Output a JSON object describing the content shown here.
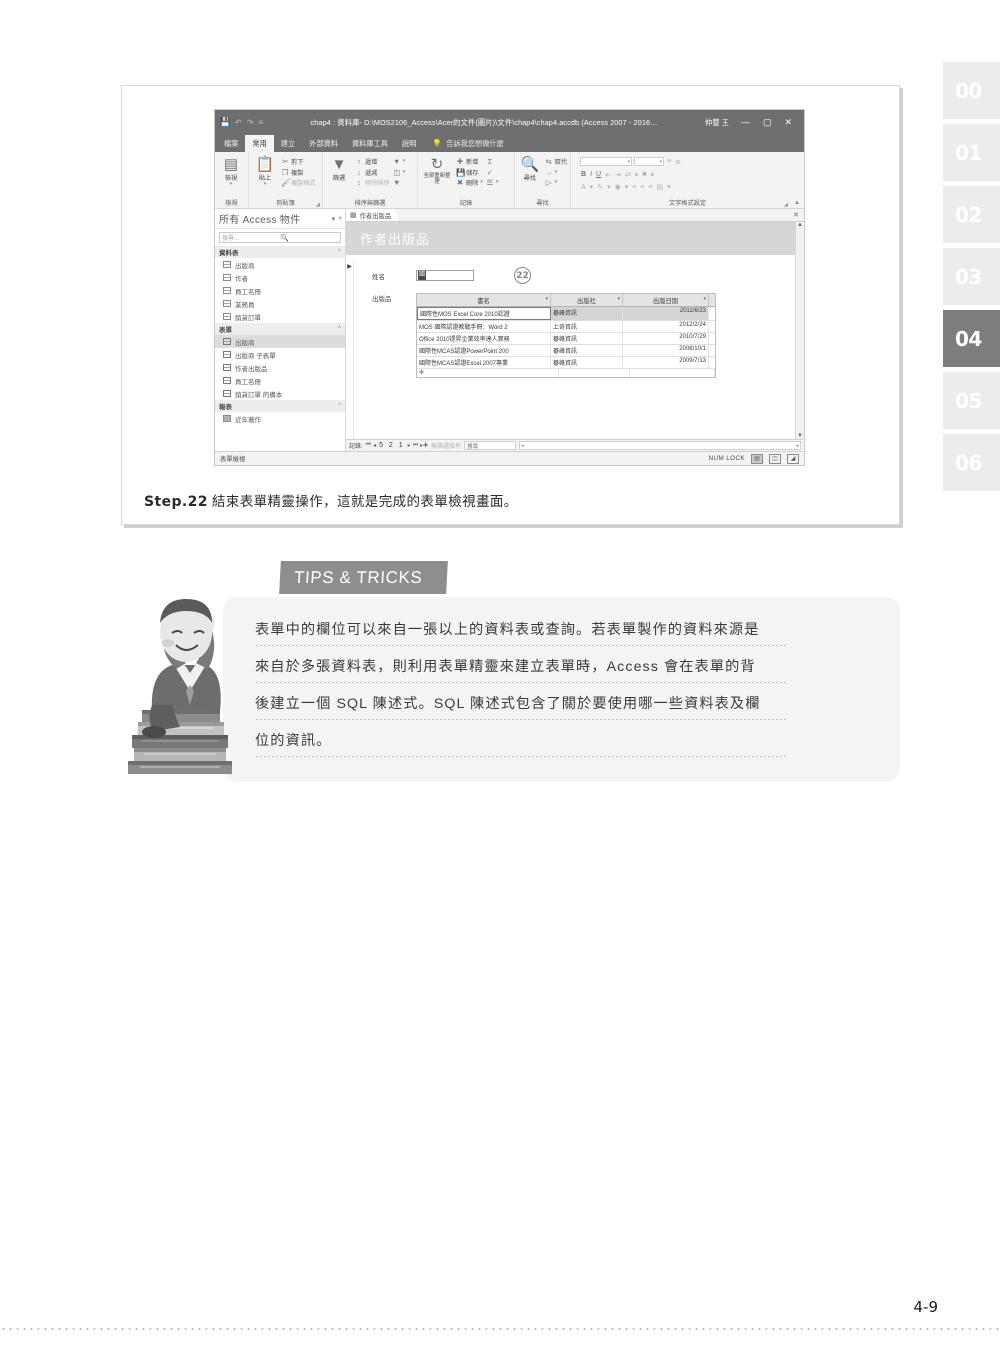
{
  "chapter_tabs": [
    {
      "label": "00",
      "active": false
    },
    {
      "label": "01",
      "active": false
    },
    {
      "label": "02",
      "active": false
    },
    {
      "label": "03",
      "active": false
    },
    {
      "label": "04",
      "active": true
    },
    {
      "label": "05",
      "active": false
    },
    {
      "label": "06",
      "active": false
    }
  ],
  "access": {
    "titlebar": {
      "save_icon": "save-icon",
      "undo_icon": "undo-icon",
      "redo_icon": "redo-icon",
      "customize_icon": "customize-qat-icon",
      "title": "chap4 : 資料庫- D:\\MOS2106_Access\\Acer的文件(圖片)\\文件\\chap4\\chap4.accdb (Access 2007 - 2016…",
      "user": "仲豐 王",
      "minimize": "—",
      "maximize": "▢",
      "close": "✕"
    },
    "ribbon_tabs": [
      {
        "label": "檔案",
        "active": false
      },
      {
        "label": "常用",
        "active": true
      },
      {
        "label": "建立",
        "active": false
      },
      {
        "label": "外部資料",
        "active": false
      },
      {
        "label": "資料庫工具",
        "active": false
      },
      {
        "label": "說明",
        "active": false
      }
    ],
    "tell_me": "告訴我您想做什麼",
    "ribbon_groups": [
      {
        "name": "檢視",
        "big": {
          "label": "檢視",
          "icon": "view-icon"
        }
      },
      {
        "name": "剪貼簿",
        "big": {
          "label": "貼上",
          "icon": "paste-icon"
        },
        "items": [
          {
            "label": "剪下",
            "icon": "cut-icon",
            "dim": false
          },
          {
            "label": "複製",
            "icon": "copy-icon",
            "dim": false
          },
          {
            "label": "複製格式",
            "icon": "format-painter-icon",
            "dim": true
          }
        ]
      },
      {
        "name": "排序與篩選",
        "big": {
          "label": "篩選",
          "icon": "filter-icon"
        },
        "items": [
          {
            "label": "遞增",
            "icon": "sort-asc-icon",
            "dim": false
          },
          {
            "label": "遞減",
            "icon": "sort-desc-icon",
            "dim": false
          },
          {
            "label": "移除排序",
            "icon": "remove-sort-icon",
            "dim": true
          }
        ],
        "items2": [
          {
            "label": "",
            "icon": "advanced-filter-icon",
            "dim": false
          },
          {
            "label": "",
            "icon": "toggle-filter-icon",
            "dim": false
          },
          {
            "label": "",
            "icon": "filter-clear-icon",
            "dim": true
          }
        ]
      },
      {
        "name": "記錄",
        "big": {
          "label": "全部重新整理",
          "icon": "refresh-all-icon"
        },
        "items": [
          {
            "label": "新增",
            "icon": "new-record-icon",
            "dim": false
          },
          {
            "label": "儲存",
            "icon": "save-record-icon",
            "dim": false
          },
          {
            "label": "刪除",
            "icon": "delete-record-icon",
            "dim": false
          }
        ],
        "items2": [
          {
            "label": "",
            "icon": "totals-icon",
            "dim": false
          },
          {
            "label": "",
            "icon": "spelling-icon",
            "dim": false
          },
          {
            "label": "",
            "icon": "more-icon",
            "dim": false
          }
        ]
      },
      {
        "name": "尋找",
        "big": {
          "label": "尋找",
          "icon": "find-icon"
        },
        "items": [
          {
            "label": "取代",
            "icon": "replace-icon",
            "dim": false
          },
          {
            "label": "",
            "icon": "goto-icon",
            "dim": false
          },
          {
            "label": "",
            "icon": "select-icon",
            "dim": false
          }
        ]
      },
      {
        "name": "文字格式設定",
        "font_box": "",
        "size_box": "",
        "items": [
          {
            "icon": "bold-icon",
            "label": "B"
          },
          {
            "icon": "italic-icon",
            "label": "I"
          },
          {
            "icon": "underline-icon",
            "label": "U"
          }
        ]
      }
    ],
    "navpane": {
      "title": "所有 Access 物件",
      "dropdown_icon": "chevron-circle-icon",
      "collapse_icon": "double-chevron-left-icon",
      "search_placeholder": "搜尋...",
      "search_icon": "search-icon",
      "groups": [
        {
          "name": "資料表",
          "items": [
            {
              "label": "出版商",
              "type": "table",
              "selected": false
            },
            {
              "label": "作者",
              "type": "table",
              "selected": false
            },
            {
              "label": "員工名冊",
              "type": "table",
              "selected": false
            },
            {
              "label": "業務員",
              "type": "table",
              "selected": false
            },
            {
              "label": "銷貨訂單",
              "type": "table",
              "selected": false
            }
          ]
        },
        {
          "name": "表單",
          "items": [
            {
              "label": "出版商",
              "type": "form",
              "selected": true
            },
            {
              "label": "出版商 子表單",
              "type": "form",
              "selected": false
            },
            {
              "label": "作者出版品",
              "type": "form",
              "selected": false
            },
            {
              "label": "員工名冊",
              "type": "form",
              "selected": false
            },
            {
              "label": "銷貨訂單 的備本",
              "type": "form",
              "selected": false
            }
          ]
        },
        {
          "name": "報表",
          "items": [
            {
              "label": "近年著作",
              "type": "report",
              "selected": false
            }
          ]
        }
      ]
    },
    "doc_tab": {
      "label": "作者出版品",
      "icon": "form-icon",
      "close_icon": "close-icon"
    },
    "form": {
      "header_title": "作者出版品",
      "record_selector_icon": "record-arrow-icon",
      "fields": [
        {
          "label": "姓名",
          "value": "國",
          "callout": "22"
        },
        {
          "label": "出版品",
          "value": ""
        }
      ],
      "subform": {
        "columns": [
          "書名",
          "出版社",
          "出版日期"
        ],
        "rows": [
          {
            "title": "國際性MOS Excel Core 2010認證",
            "publisher": "碁峰資訊",
            "date": "2011/6/23"
          },
          {
            "title": "MOS 國際認證教戰手冊：Word 2",
            "publisher": "上奇資訊",
            "date": "2012/2/24"
          },
          {
            "title": "Office 2010提昇企業效率達人實務",
            "publisher": "碁峰資訊",
            "date": "2010/7/29"
          },
          {
            "title": "國際性MCAS認證PowerPoint 200",
            "publisher": "碁峰資訊",
            "date": "2008/10/1"
          },
          {
            "title": "國際性MCAS認證Excel 2007專業",
            "publisher": "碁峰資訊",
            "date": "2009/7/13"
          }
        ],
        "new_row_marker": "✻"
      },
      "navbar": {
        "label": "記錄:",
        "first_icon": "first-record-icon",
        "prev_icon": "prev-record-icon",
        "position": "5 2 1",
        "next_icon": "next-record-icon",
        "last_icon": "last-record-icon",
        "new_icon": "new-record-icon",
        "filter_status": "無篩選條件",
        "search_label": "搜尋",
        "search_value": ""
      }
    },
    "statusbar": {
      "left": "表單檢視",
      "numlock": "NUM LOCK",
      "views": [
        {
          "icon": "form-view-icon",
          "active": true
        },
        {
          "icon": "layout-view-icon",
          "active": false
        },
        {
          "icon": "design-view-icon",
          "active": false
        }
      ]
    }
  },
  "step_caption": {
    "number": "Step.22",
    "text": "結束表單精靈操作，這就是完成的表單檢視畫面。"
  },
  "tips": {
    "badge": "TIPS & TRICKS",
    "lines": [
      "表單中的欄位可以來自一張以上的資料表或查詢。若表單製作的資料來源是",
      "來自於多張資料表，則利用表單精靈來建立表單時，Access 會在表單的背",
      "後建立一個 SQL 陳述式。SQL 陳述式包含了關於要使用哪一些資料表及欄",
      "位的資訊。"
    ]
  },
  "footer": {
    "page_number": "4-9"
  }
}
